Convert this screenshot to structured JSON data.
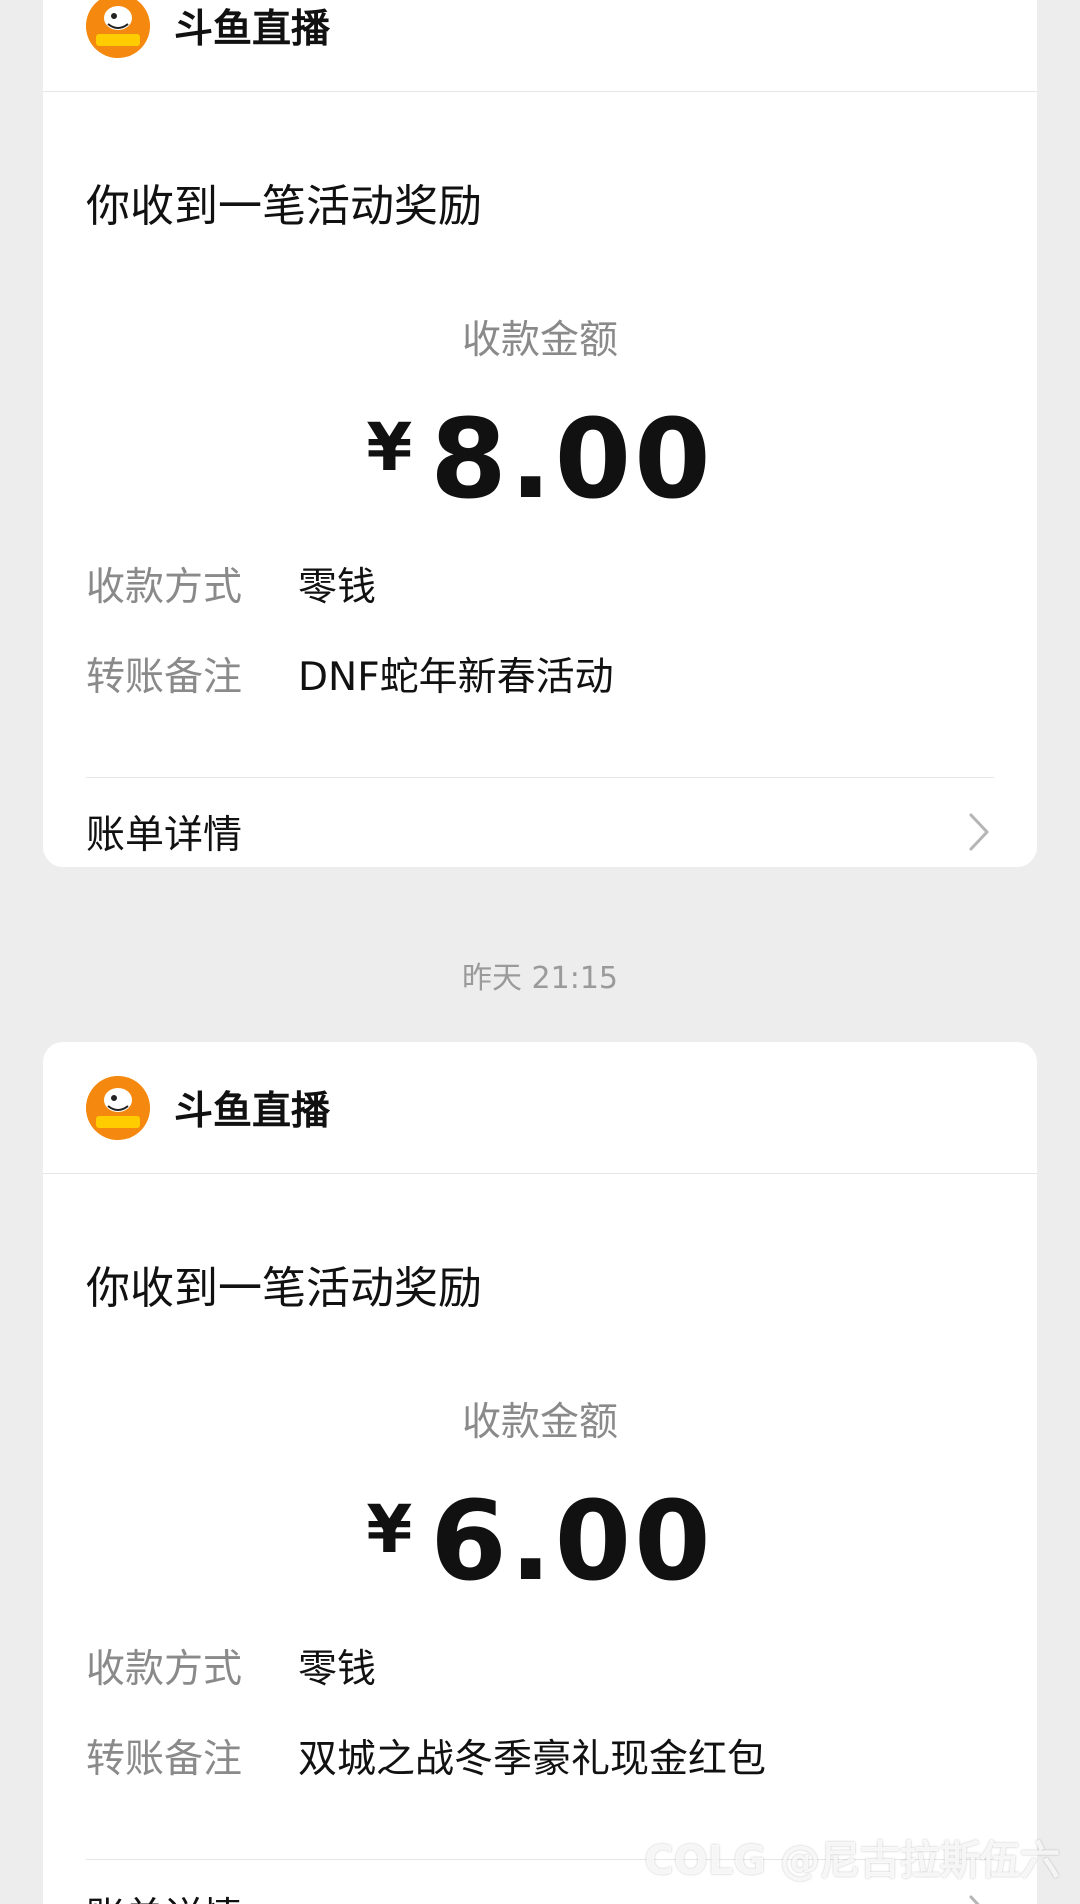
{
  "cards": [
    {
      "merchant": {
        "name": "斗鱼直播",
        "logo_text": "DOUYU"
      },
      "title": "你收到一笔活动奖励",
      "amount_label": "收款金额",
      "currency": "¥",
      "amount": "8.00",
      "rows": [
        {
          "key": "收款方式",
          "value": "零钱"
        },
        {
          "key": "转账备注",
          "value": "DNF蛇年新春活动"
        }
      ],
      "detail_label": "账单详情"
    },
    {
      "merchant": {
        "name": "斗鱼直播",
        "logo_text": "DOUYU"
      },
      "title": "你收到一笔活动奖励",
      "amount_label": "收款金额",
      "currency": "¥",
      "amount": "6.00",
      "rows": [
        {
          "key": "收款方式",
          "value": "零钱"
        },
        {
          "key": "转账备注",
          "value": "双城之战冬季豪礼现金红包"
        }
      ],
      "detail_label": "账单详情"
    }
  ],
  "timestamp": "昨天 21:15",
  "watermark": "COLG @尼古拉斯伍六",
  "colors": {
    "background": "#ededed",
    "card": "#ffffff",
    "logo": "#f5890f",
    "secondary_text": "#8a8a8a"
  }
}
